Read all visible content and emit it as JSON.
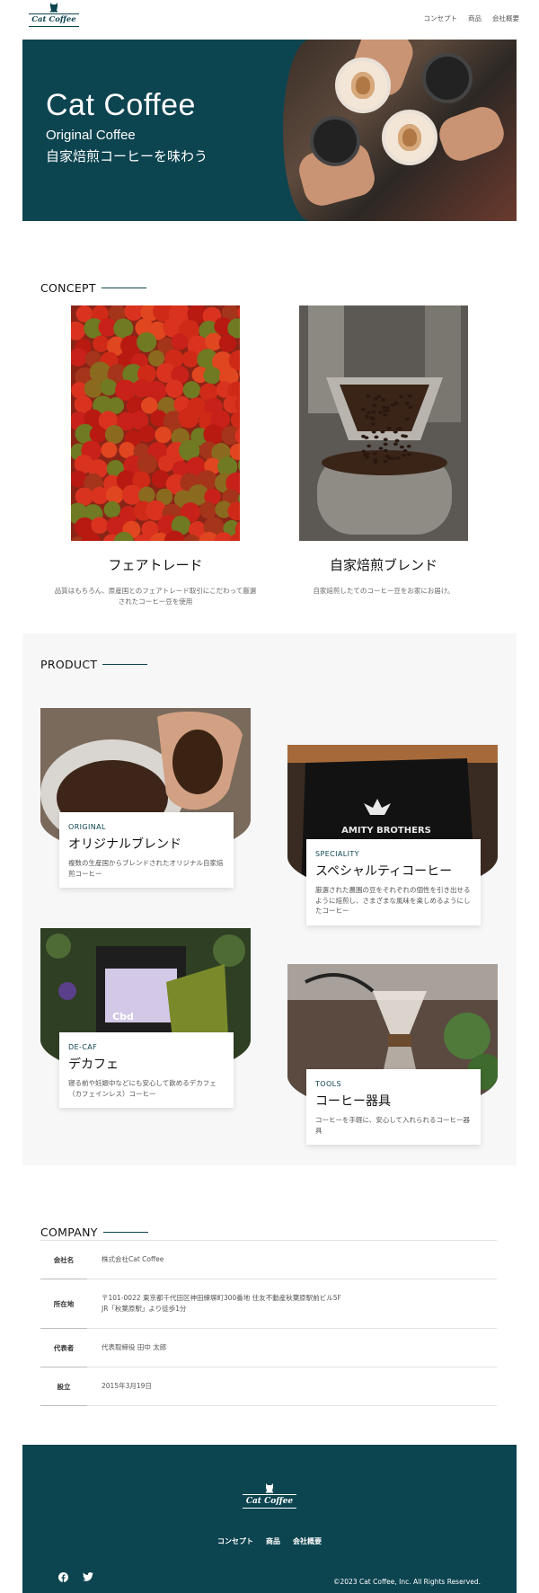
{
  "brand": {
    "logo_text": "Cat Coffee"
  },
  "nav": {
    "items": [
      "コンセプト",
      "商品",
      "会社概要"
    ]
  },
  "hero": {
    "title": "Cat Coffee",
    "subtitle_en": "Original Coffee",
    "subtitle_ja": "自家焙煎コーヒーを味わう"
  },
  "concept": {
    "heading": "CONCEPT",
    "items": [
      {
        "title": "フェアトレード",
        "text": "品質はもちろん、原産国とのフェアトレード取引にこだわって厳選されたコーヒー豆を使用",
        "image": "coffee-cherries"
      },
      {
        "title": "自家焙煎ブレンド",
        "text": "自家焙煎したてのコーヒー豆をお家にお届け。",
        "image": "coffee-roaster"
      }
    ]
  },
  "product": {
    "heading": "PRODUCT",
    "items": [
      {
        "tag": "ORIGINAL",
        "name": "オリジナルブレンド",
        "desc": "複数の生産国からブレンドされたオリジナル自家焙煎コーヒー",
        "image": "beans-in-hand"
      },
      {
        "tag": "SPECIALITY",
        "name": "スペシャルティコーヒー",
        "desc": "厳選された農園の豆をそれぞれの個性を引き出せるように焙煎し、さまざまな風味を楽しめるようにしたコーヒー",
        "image": "amity-brothers-bag",
        "image_text": "AMITY BROTHERS"
      },
      {
        "tag": "DE-CAF",
        "name": "デカフェ",
        "desc": "寝る前や妊娠中などにも安心して飲めるデカフェ（カフェインレス）コーヒー",
        "image": "cbd-coffee-bags",
        "image_text": "Cbd"
      },
      {
        "tag": "TOOLS",
        "name": "コーヒー器具",
        "desc": "コーヒーを手軽に、安心して入れられるコーヒー器具",
        "image": "pour-over-chemex"
      }
    ]
  },
  "company": {
    "heading": "COMPANY",
    "rows": [
      {
        "key": "会社名",
        "lines": [
          "株式会社Cat Coffee"
        ]
      },
      {
        "key": "所在地",
        "lines": [
          "〒101-0022 東京都千代田区神田練塀町300番地 住友不動産秋葉原駅前ビル5F",
          "JR「秋葉原駅」より徒歩1分"
        ]
      },
      {
        "key": "代表者",
        "lines": [
          "代表取締役 田中 太郎"
        ]
      },
      {
        "key": "設立",
        "lines": [
          "2015年3月19日"
        ]
      }
    ]
  },
  "footer": {
    "logo_text": "Cat Coffee",
    "nav": [
      "コンセプト",
      "商品",
      "会社概要"
    ],
    "social": [
      "facebook-icon",
      "twitter-icon"
    ],
    "copyright": "©2023 Cat Coffee, Inc. All Rights Reserved."
  },
  "colors": {
    "brand": "#0c4450",
    "product_bg": "#f7f7f7"
  }
}
